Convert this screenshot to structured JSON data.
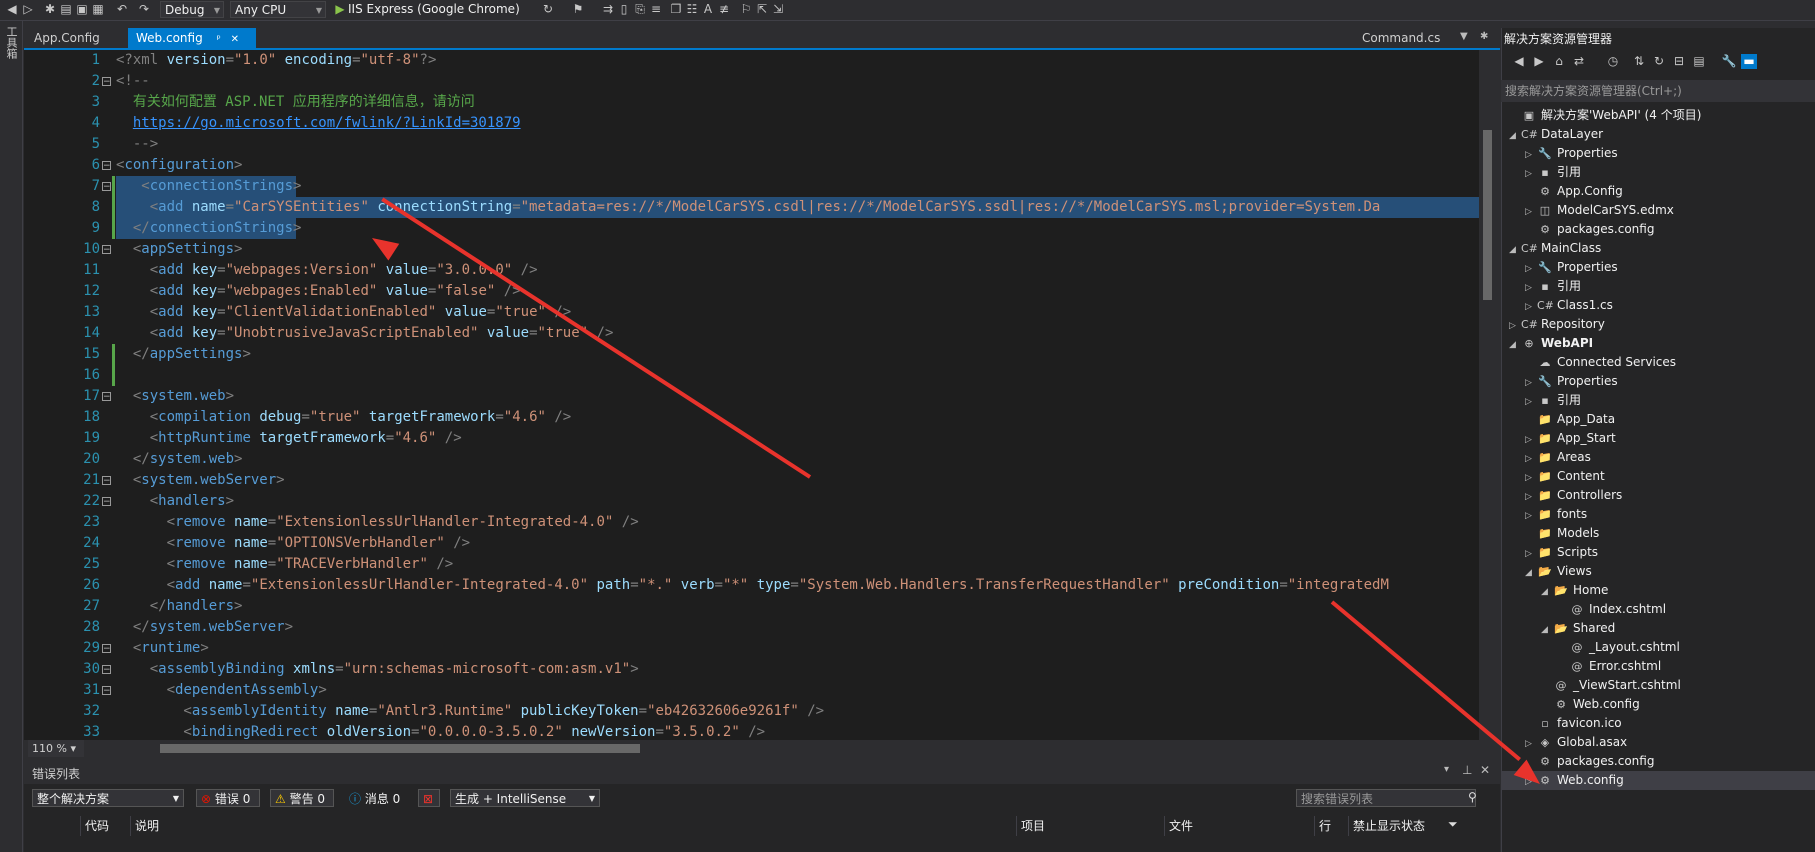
{
  "toolbar": {
    "config": "Debug",
    "platform": "Any CPU",
    "run_target": "IIS Express (Google Chrome)"
  },
  "toolbox": {
    "label": "工具箱"
  },
  "tabs": {
    "left": [
      {
        "label": "App.Config"
      },
      {
        "label": "Web.config",
        "pin": "ᵖ",
        "close": "✕"
      }
    ],
    "right": {
      "label": "Command.cs"
    }
  },
  "editor": {
    "zoom": "110 %",
    "lines": [
      {
        "n": "1",
        "segs": [
          [
            "t-d",
            "<?xml "
          ],
          [
            "t-a",
            "version"
          ],
          [
            "t-p",
            "="
          ],
          [
            "t-v",
            "\"1.0\""
          ],
          [
            "t-p",
            " "
          ],
          [
            "t-a",
            "encoding"
          ],
          [
            "t-p",
            "="
          ],
          [
            "t-v",
            "\"utf-8\""
          ],
          [
            "t-d",
            "?>"
          ]
        ]
      },
      {
        "n": "2",
        "segs": [
          [
            "t-p",
            "<!--"
          ]
        ]
      },
      {
        "n": "3",
        "segs": [
          [
            "t-c",
            "  有关如何配置 ASP.NET 应用程序的详细信息，请访问"
          ]
        ]
      },
      {
        "n": "4",
        "segs": [
          [
            "t-p",
            "  "
          ],
          [
            "t-l",
            "https://go.microsoft.com/fwlink/?LinkId=301879"
          ]
        ]
      },
      {
        "n": "5",
        "segs": [
          [
            "t-p",
            "  -->"
          ]
        ]
      },
      {
        "n": "6",
        "segs": [
          [
            "t-d",
            "<"
          ],
          [
            "t-t",
            "configuration"
          ],
          [
            "t-d",
            ">"
          ]
        ]
      },
      {
        "n": "7",
        "segs": [
          [
            "t-d",
            "   <"
          ],
          [
            "t-t",
            "connectionStrings"
          ],
          [
            "t-d",
            ">"
          ]
        ]
      },
      {
        "n": "8",
        "segs": [
          [
            "t-d",
            "    <"
          ],
          [
            "t-t",
            "add "
          ],
          [
            "t-a",
            "name"
          ],
          [
            "t-p",
            "="
          ],
          [
            "t-v",
            "\"CarSYSEntities\""
          ],
          [
            "t-p",
            " "
          ],
          [
            "t-a",
            "connectionString"
          ],
          [
            "t-p",
            "="
          ],
          [
            "t-v",
            "\"metadata=res://*/ModelCarSYS.csdl|res://*/ModelCarSYS.ssdl|res://*/ModelCarSYS.msl;provider=System.Da"
          ]
        ]
      },
      {
        "n": "9",
        "segs": [
          [
            "t-d",
            "  </"
          ],
          [
            "t-t",
            "connectionStrings"
          ],
          [
            "t-d",
            ">"
          ]
        ]
      },
      {
        "n": "10",
        "segs": [
          [
            "t-d",
            "  <"
          ],
          [
            "t-t",
            "appSettings"
          ],
          [
            "t-d",
            ">"
          ]
        ]
      },
      {
        "n": "11",
        "segs": [
          [
            "t-d",
            "    <"
          ],
          [
            "t-t",
            "add "
          ],
          [
            "t-a",
            "key"
          ],
          [
            "t-p",
            "="
          ],
          [
            "t-v",
            "\"webpages:Version\""
          ],
          [
            "t-p",
            " "
          ],
          [
            "t-a",
            "value"
          ],
          [
            "t-p",
            "="
          ],
          [
            "t-v",
            "\"3.0.0.0\""
          ],
          [
            "t-d",
            " />"
          ]
        ]
      },
      {
        "n": "12",
        "segs": [
          [
            "t-d",
            "    <"
          ],
          [
            "t-t",
            "add "
          ],
          [
            "t-a",
            "key"
          ],
          [
            "t-p",
            "="
          ],
          [
            "t-v",
            "\"webpages:Enabled\""
          ],
          [
            "t-p",
            " "
          ],
          [
            "t-a",
            "value"
          ],
          [
            "t-p",
            "="
          ],
          [
            "t-v",
            "\"false\""
          ],
          [
            "t-d",
            " />"
          ]
        ]
      },
      {
        "n": "13",
        "segs": [
          [
            "t-d",
            "    <"
          ],
          [
            "t-t",
            "add "
          ],
          [
            "t-a",
            "key"
          ],
          [
            "t-p",
            "="
          ],
          [
            "t-v",
            "\"ClientValidationEnabled\""
          ],
          [
            "t-p",
            " "
          ],
          [
            "t-a",
            "value"
          ],
          [
            "t-p",
            "="
          ],
          [
            "t-v",
            "\"true\""
          ],
          [
            "t-d",
            " />"
          ]
        ]
      },
      {
        "n": "14",
        "segs": [
          [
            "t-d",
            "    <"
          ],
          [
            "t-t",
            "add "
          ],
          [
            "t-a",
            "key"
          ],
          [
            "t-p",
            "="
          ],
          [
            "t-v",
            "\"UnobtrusiveJavaScriptEnabled\""
          ],
          [
            "t-p",
            " "
          ],
          [
            "t-a",
            "value"
          ],
          [
            "t-p",
            "="
          ],
          [
            "t-v",
            "\"true\""
          ],
          [
            "t-d",
            " />"
          ]
        ]
      },
      {
        "n": "15",
        "segs": [
          [
            "t-d",
            "  </"
          ],
          [
            "t-t",
            "appSettings"
          ],
          [
            "t-d",
            ">"
          ]
        ]
      },
      {
        "n": "16",
        "segs": [
          [
            "t-p",
            ""
          ]
        ]
      },
      {
        "n": "17",
        "segs": [
          [
            "t-d",
            "  <"
          ],
          [
            "t-t",
            "system.web"
          ],
          [
            "t-d",
            ">"
          ]
        ]
      },
      {
        "n": "18",
        "segs": [
          [
            "t-d",
            "    <"
          ],
          [
            "t-t",
            "compilation "
          ],
          [
            "t-a",
            "debug"
          ],
          [
            "t-p",
            "="
          ],
          [
            "t-v",
            "\"true\""
          ],
          [
            "t-p",
            " "
          ],
          [
            "t-a",
            "targetFramework"
          ],
          [
            "t-p",
            "="
          ],
          [
            "t-v",
            "\"4.6\""
          ],
          [
            "t-d",
            " />"
          ]
        ]
      },
      {
        "n": "19",
        "segs": [
          [
            "t-d",
            "    <"
          ],
          [
            "t-t",
            "httpRuntime "
          ],
          [
            "t-a",
            "targetFramework"
          ],
          [
            "t-p",
            "="
          ],
          [
            "t-v",
            "\"4.6\""
          ],
          [
            "t-d",
            " />"
          ]
        ]
      },
      {
        "n": "20",
        "segs": [
          [
            "t-d",
            "  </"
          ],
          [
            "t-t",
            "system.web"
          ],
          [
            "t-d",
            ">"
          ]
        ]
      },
      {
        "n": "21",
        "segs": [
          [
            "t-d",
            "  <"
          ],
          [
            "t-t",
            "system.webServer"
          ],
          [
            "t-d",
            ">"
          ]
        ]
      },
      {
        "n": "22",
        "segs": [
          [
            "t-d",
            "    <"
          ],
          [
            "t-t",
            "handlers"
          ],
          [
            "t-d",
            ">"
          ]
        ]
      },
      {
        "n": "23",
        "segs": [
          [
            "t-d",
            "      <"
          ],
          [
            "t-t",
            "remove "
          ],
          [
            "t-a",
            "name"
          ],
          [
            "t-p",
            "="
          ],
          [
            "t-v",
            "\"ExtensionlessUrlHandler-Integrated-4.0\""
          ],
          [
            "t-d",
            " />"
          ]
        ]
      },
      {
        "n": "24",
        "segs": [
          [
            "t-d",
            "      <"
          ],
          [
            "t-t",
            "remove "
          ],
          [
            "t-a",
            "name"
          ],
          [
            "t-p",
            "="
          ],
          [
            "t-v",
            "\"OPTIONSVerbHandler\""
          ],
          [
            "t-d",
            " />"
          ]
        ]
      },
      {
        "n": "25",
        "segs": [
          [
            "t-d",
            "      <"
          ],
          [
            "t-t",
            "remove "
          ],
          [
            "t-a",
            "name"
          ],
          [
            "t-p",
            "="
          ],
          [
            "t-v",
            "\"TRACEVerbHandler\""
          ],
          [
            "t-d",
            " />"
          ]
        ]
      },
      {
        "n": "26",
        "segs": [
          [
            "t-d",
            "      <"
          ],
          [
            "t-t",
            "add "
          ],
          [
            "t-a",
            "name"
          ],
          [
            "t-p",
            "="
          ],
          [
            "t-v",
            "\"ExtensionlessUrlHandler-Integrated-4.0\""
          ],
          [
            "t-p",
            " "
          ],
          [
            "t-a",
            "path"
          ],
          [
            "t-p",
            "="
          ],
          [
            "t-v",
            "\"*.\""
          ],
          [
            "t-p",
            " "
          ],
          [
            "t-a",
            "verb"
          ],
          [
            "t-p",
            "="
          ],
          [
            "t-v",
            "\"*\""
          ],
          [
            "t-p",
            " "
          ],
          [
            "t-a",
            "type"
          ],
          [
            "t-p",
            "="
          ],
          [
            "t-v",
            "\"System.Web.Handlers.TransferRequestHandler\""
          ],
          [
            "t-p",
            " "
          ],
          [
            "t-a",
            "preCondition"
          ],
          [
            "t-p",
            "="
          ],
          [
            "t-v",
            "\"integratedM"
          ]
        ]
      },
      {
        "n": "27",
        "segs": [
          [
            "t-d",
            "    </"
          ],
          [
            "t-t",
            "handlers"
          ],
          [
            "t-d",
            ">"
          ]
        ]
      },
      {
        "n": "28",
        "segs": [
          [
            "t-d",
            "  </"
          ],
          [
            "t-t",
            "system.webServer"
          ],
          [
            "t-d",
            ">"
          ]
        ]
      },
      {
        "n": "29",
        "segs": [
          [
            "t-d",
            "  <"
          ],
          [
            "t-t",
            "runtime"
          ],
          [
            "t-d",
            ">"
          ]
        ]
      },
      {
        "n": "30",
        "segs": [
          [
            "t-d",
            "    <"
          ],
          [
            "t-t",
            "assemblyBinding "
          ],
          [
            "t-a",
            "xmlns"
          ],
          [
            "t-p",
            "="
          ],
          [
            "t-v",
            "\"urn:schemas-microsoft-com:asm.v1\""
          ],
          [
            "t-d",
            ">"
          ]
        ]
      },
      {
        "n": "31",
        "segs": [
          [
            "t-d",
            "      <"
          ],
          [
            "t-t",
            "dependentAssembly"
          ],
          [
            "t-d",
            ">"
          ]
        ]
      },
      {
        "n": "32",
        "segs": [
          [
            "t-d",
            "        <"
          ],
          [
            "t-t",
            "assemblyIdentity "
          ],
          [
            "t-a",
            "name"
          ],
          [
            "t-p",
            "="
          ],
          [
            "t-v",
            "\"Antlr3.Runtime\""
          ],
          [
            "t-p",
            " "
          ],
          [
            "t-a",
            "publicKeyToken"
          ],
          [
            "t-p",
            "="
          ],
          [
            "t-v",
            "\"eb42632606e9261f\""
          ],
          [
            "t-d",
            " />"
          ]
        ]
      },
      {
        "n": "33",
        "segs": [
          [
            "t-d",
            "        <"
          ],
          [
            "t-t",
            "bindingRedirect "
          ],
          [
            "t-a",
            "oldVersion"
          ],
          [
            "t-p",
            "="
          ],
          [
            "t-v",
            "\"0.0.0.0-3.5.0.2\""
          ],
          [
            "t-p",
            " "
          ],
          [
            "t-a",
            "newVersion"
          ],
          [
            "t-p",
            "="
          ],
          [
            "t-v",
            "\"3.5.0.2\""
          ],
          [
            "t-d",
            " />"
          ]
        ]
      }
    ]
  },
  "error_list": {
    "title": "错误列表",
    "scope": "整个解决方案",
    "errors": "错误 0",
    "warnings": "警告 0",
    "messages": "消息 0",
    "build_filter": "生成 + IntelliSense",
    "search_placeholder": "搜索错误列表",
    "columns": [
      "代码",
      "说明",
      "项目",
      "文件",
      "行",
      "禁止显示状态"
    ]
  },
  "solution_explorer": {
    "title": "解决方案资源管理器",
    "search_placeholder": "搜索解决方案资源管理器(Ctrl+;)",
    "items": [
      {
        "label": "解决方案'WebAPI' (4 个项目)",
        "depth": 0,
        "tw": "",
        "ic": "▣"
      },
      {
        "label": "DataLayer",
        "depth": 0,
        "tw": "◢",
        "ic": "C#"
      },
      {
        "label": "Properties",
        "depth": 1,
        "tw": "▷",
        "ic": "🔧"
      },
      {
        "label": "引用",
        "depth": 1,
        "tw": "▷",
        "ic": "▪"
      },
      {
        "label": "App.Config",
        "depth": 1,
        "tw": "",
        "ic": "⚙"
      },
      {
        "label": "ModelCarSYS.edmx",
        "depth": 1,
        "tw": "▷",
        "ic": "◫"
      },
      {
        "label": "packages.config",
        "depth": 1,
        "tw": "",
        "ic": "⚙"
      },
      {
        "label": "MainClass",
        "depth": 0,
        "tw": "◢",
        "ic": "C#"
      },
      {
        "label": "Properties",
        "depth": 1,
        "tw": "▷",
        "ic": "🔧"
      },
      {
        "label": "引用",
        "depth": 1,
        "tw": "▷",
        "ic": "▪"
      },
      {
        "label": "Class1.cs",
        "depth": 1,
        "tw": "▷",
        "ic": "C#"
      },
      {
        "label": "Repository",
        "depth": 0,
        "tw": "▷",
        "ic": "C#"
      },
      {
        "label": "WebAPI",
        "depth": 0,
        "tw": "◢",
        "ic": "⊕",
        "bold": true
      },
      {
        "label": "Connected Services",
        "depth": 1,
        "tw": "",
        "ic": "☁"
      },
      {
        "label": "Properties",
        "depth": 1,
        "tw": "▷",
        "ic": "🔧"
      },
      {
        "label": "引用",
        "depth": 1,
        "tw": "▷",
        "ic": "▪"
      },
      {
        "label": "App_Data",
        "depth": 1,
        "tw": "",
        "ic": "📁"
      },
      {
        "label": "App_Start",
        "depth": 1,
        "tw": "▷",
        "ic": "📁"
      },
      {
        "label": "Areas",
        "depth": 1,
        "tw": "▷",
        "ic": "📁"
      },
      {
        "label": "Content",
        "depth": 1,
        "tw": "▷",
        "ic": "📁"
      },
      {
        "label": "Controllers",
        "depth": 1,
        "tw": "▷",
        "ic": "📁"
      },
      {
        "label": "fonts",
        "depth": 1,
        "tw": "▷",
        "ic": "📁"
      },
      {
        "label": "Models",
        "depth": 1,
        "tw": "",
        "ic": "📁"
      },
      {
        "label": "Scripts",
        "depth": 1,
        "tw": "▷",
        "ic": "📁"
      },
      {
        "label": "Views",
        "depth": 1,
        "tw": "◢",
        "ic": "📂"
      },
      {
        "label": "Home",
        "depth": 2,
        "tw": "◢",
        "ic": "📂"
      },
      {
        "label": "Index.cshtml",
        "depth": 3,
        "tw": "",
        "ic": "@"
      },
      {
        "label": "Shared",
        "depth": 2,
        "tw": "◢",
        "ic": "📂"
      },
      {
        "label": "_Layout.cshtml",
        "depth": 3,
        "tw": "",
        "ic": "@"
      },
      {
        "label": "Error.cshtml",
        "depth": 3,
        "tw": "",
        "ic": "@"
      },
      {
        "label": "_ViewStart.cshtml",
        "depth": 2,
        "tw": "",
        "ic": "@"
      },
      {
        "label": "Web.config",
        "depth": 2,
        "tw": "",
        "ic": "⚙"
      },
      {
        "label": "favicon.ico",
        "depth": 1,
        "tw": "",
        "ic": "▫"
      },
      {
        "label": "Global.asax",
        "depth": 1,
        "tw": "▷",
        "ic": "◈"
      },
      {
        "label": "packages.config",
        "depth": 1,
        "tw": "",
        "ic": "⚙"
      },
      {
        "label": "Web.config",
        "depth": 1,
        "tw": "▷",
        "ic": "⚙",
        "selected": true
      }
    ]
  },
  "colors": {
    "accent": "#007acc",
    "annotation_arrow": "#e8332c",
    "selection": "#264f78"
  }
}
